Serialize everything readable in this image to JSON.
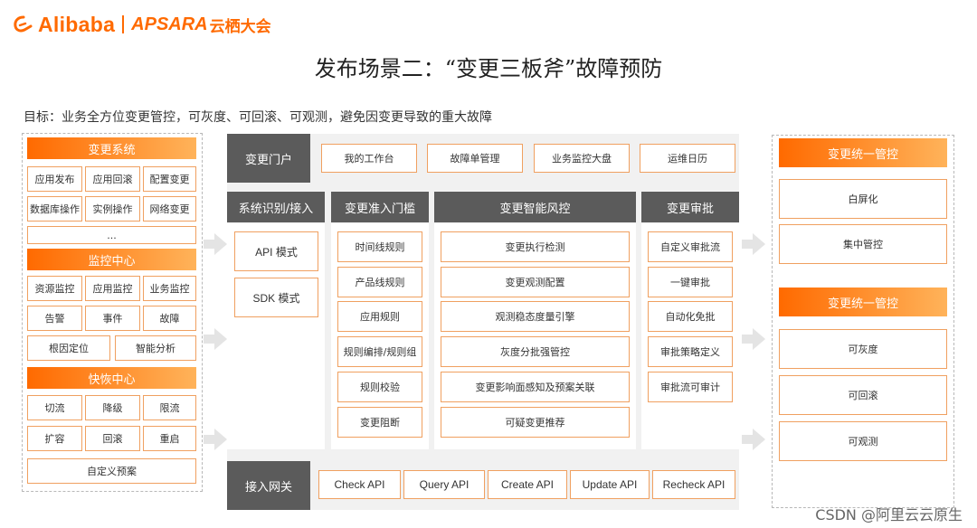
{
  "header": {
    "logo_alibaba": "Alibaba",
    "logo_apsara": "APSARA",
    "logo_yunqi": "云栖大会",
    "title": "发布场景二：“变更三板斧”故障预防",
    "goal": "目标：业务全方位变更管控，可灰度、可回滚、可观测，避免因变更导致的重大故障"
  },
  "left": {
    "change_system": {
      "title": "变更系统",
      "items": [
        "应用发布",
        "应用回滚",
        "配置变更",
        "数据库操作",
        "实例操作",
        "网络变更"
      ],
      "ellipsis": "..."
    },
    "monitor_center": {
      "title": "监控中心",
      "items": [
        "资源监控",
        "应用监控",
        "业务监控",
        "告警",
        "事件",
        "故障"
      ],
      "items2": [
        "根因定位",
        "智能分析"
      ]
    },
    "recovery_center": {
      "title": "快恢中心",
      "items": [
        "切流",
        "降级",
        "限流",
        "扩容",
        "回滚",
        "重启"
      ],
      "custom_plan": "自定义预案"
    }
  },
  "middle": {
    "portal": {
      "title": "变更门户",
      "items": [
        "我的工作台",
        "故障单管理",
        "业务监控大盘",
        "运维日历"
      ]
    },
    "identify": {
      "title": "系统识别/接入",
      "items": [
        "API 模式",
        "SDK 模式"
      ]
    },
    "admission": {
      "title": "变更准入门槛",
      "items": [
        "时间线规则",
        "产品线规则",
        "应用规则",
        "规则编排/规则组",
        "规则校验",
        "变更阻断"
      ]
    },
    "risk": {
      "title": "变更智能风控",
      "items": [
        "变更执行检测",
        "变更观测配置",
        "观测稳态度量引擎",
        "灰度分批强管控",
        "变更影响面感知及预案关联",
        "可疑变更推荐"
      ]
    },
    "approval": {
      "title": "变更审批",
      "items": [
        "自定义审批流",
        "一键审批",
        "自动化免批",
        "审批策略定义",
        "审批流可审计"
      ]
    },
    "gateway": {
      "title": "接入网关",
      "items": [
        "Check API",
        "Query API",
        "Create API",
        "Update API",
        "Recheck API"
      ]
    }
  },
  "right": {
    "group1": {
      "title": "变更统一管控",
      "items": [
        "白屏化",
        "集中管控"
      ]
    },
    "group2": {
      "title": "变更统一管控",
      "items": [
        "可灰度",
        "可回滚",
        "可观测"
      ]
    }
  },
  "watermark": "CSDN @阿里云云原生",
  "colors": {
    "accent": "#ff6a00",
    "accent_light": "#ffb35a",
    "dark_header": "#5b5b5b",
    "panel_bg": "#f1f1f1"
  }
}
